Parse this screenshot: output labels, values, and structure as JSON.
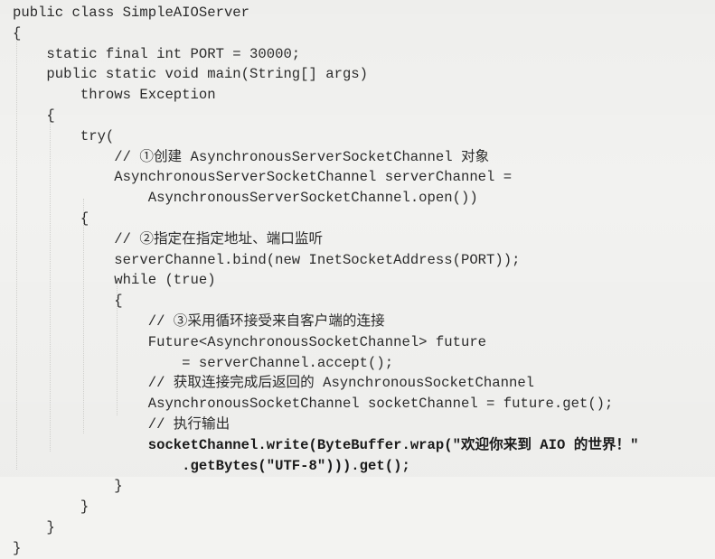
{
  "code_lines": [
    "public class SimpleAIOServer",
    "{",
    "    static final int PORT = 30000;",
    "    public static void main(String[] args)",
    "        throws Exception",
    "    {",
    "        try(",
    "            // ①创建 AsynchronousServerSocketChannel 对象",
    "            AsynchronousServerSocketChannel serverChannel =",
    "                AsynchronousServerSocketChannel.open())",
    "        {",
    "            // ②指定在指定地址、端口监听",
    "            serverChannel.bind(new InetSocketAddress(PORT));",
    "            while (true)",
    "            {",
    "                // ③采用循环接受来自客户端的连接",
    "                Future<AsynchronousSocketChannel> future",
    "                    = serverChannel.accept();",
    "                // 获取连接完成后返回的 AsynchronousSocketChannel",
    "                AsynchronousSocketChannel socketChannel = future.get();",
    "                // 执行输出",
    "                socketChannel.write(ByteBuffer.wrap(\"欢迎你来到 AIO 的世界！\"",
    "                    .getBytes(\"UTF-8\"))).get();",
    "            }",
    "        }",
    "    }",
    "}"
  ]
}
